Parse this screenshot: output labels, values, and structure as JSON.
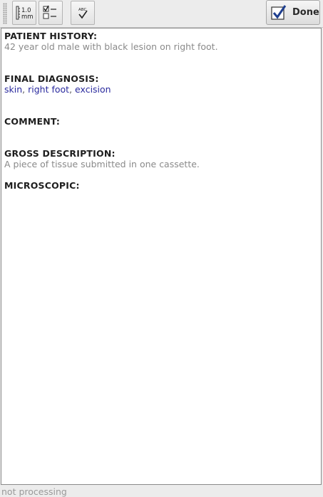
{
  "toolbar": {
    "buttons": [
      {
        "name": "ruler-measurement-button",
        "icon": "ruler-mm-icon",
        "icon_text_top": "1.0",
        "icon_text_bottom": "mm"
      },
      {
        "name": "checklist-button",
        "icon": "checklist-icon"
      },
      {
        "name": "spellcheck-button",
        "icon": "spellcheck-icon",
        "icon_text": "ABC"
      }
    ],
    "done_label": "Done"
  },
  "report": {
    "patient_history": {
      "heading": "PATIENT HISTORY:",
      "text": "42 year old male with black lesion on right foot."
    },
    "final_diagnosis": {
      "heading": "FINAL DIAGNOSIS:",
      "keywords": [
        "skin",
        "right foot",
        "excision"
      ],
      "separator": ","
    },
    "comment": {
      "heading": "COMMENT:"
    },
    "gross_description": {
      "heading": "GROSS DESCRIPTION:",
      "text": "A piece of tissue submitted in one cassette."
    },
    "microscopic": {
      "heading": "MICROSCOPIC:"
    }
  },
  "status": "not processing",
  "colors": {
    "heading": "#1e1e1e",
    "body_text": "#8a8a8a",
    "keyword": "#2a2a9e",
    "status_text": "#9a9a9a",
    "checkbox_blue": "#1f3f8f"
  }
}
